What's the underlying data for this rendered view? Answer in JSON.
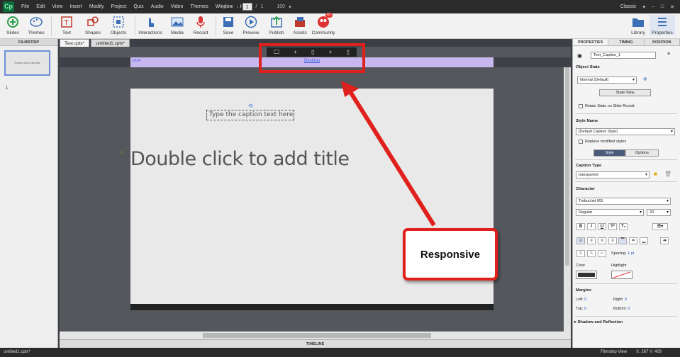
{
  "app": {
    "logo": "Cp",
    "workspace": "Classic"
  },
  "menu": [
    "File",
    "Edit",
    "View",
    "Insert",
    "Modify",
    "Project",
    "Quiz",
    "Audio",
    "Video",
    "Themes",
    "Window",
    "Help"
  ],
  "slide_nav": {
    "current": "1",
    "separator": "/",
    "total": "1",
    "zoom": "100"
  },
  "toolbar": {
    "slides": "Slides",
    "themes": "Themes",
    "text": "Text",
    "shapes": "Shapes",
    "objects": "Objects",
    "interactions": "Interactions",
    "media": "Media",
    "record": "Record",
    "save": "Save",
    "preview": "Preview",
    "publish": "Publish",
    "assets": "Assets",
    "community": "Community",
    "community_badge": "41",
    "library": "Library",
    "properties": "Properties"
  },
  "filmstrip": {
    "header": "FILMSTRIP",
    "thumb_text": "Double click to add title",
    "slide_number": "1"
  },
  "tabs": [
    "Test.cptx*",
    "untitled1.cptx*"
  ],
  "stage": {
    "breakpoint_start": "1024",
    "breakpoint_name": "Desktop",
    "title_placeholder": "Double click to add title",
    "caption_placeholder": "Type the caption text here"
  },
  "annotation": {
    "callout_text": "Responsive",
    "color": "#e0201c"
  },
  "timeline": "TIMELINE",
  "props": {
    "tabs": [
      "PROPERTIES",
      "TIMING",
      "POSITION"
    ],
    "object_name": "Text_Caption_1",
    "object_state_head": "Object State",
    "state_value": "Normal (Default)",
    "state_view_btn": "State View",
    "retain_state": "Retain State on Slide Revisit",
    "style_name_head": "Style Name",
    "style_value": "[Default Caption Style]",
    "replace_styles": "Replace modified styles",
    "subtab_style": "Style",
    "subtab_options": "Options",
    "caption_type_head": "Caption Type",
    "caption_type": "transparent",
    "character_head": "Character",
    "font": "Trebuchet MS",
    "font_style": "Regular",
    "font_size": "20",
    "spacing_label": "Spacing:",
    "spacing_value": "1 pt",
    "color_label": "Color",
    "highlight_label": "Highlight",
    "margins_head": "Margins",
    "left_label": "Left:",
    "left_value": "0",
    "right_label": "Right:",
    "right_value": "0",
    "top_label": "Top:",
    "top_value": "0",
    "bottom_label": "Bottom:",
    "bottom_value": "0",
    "shadow_head": "Shadow and Reflection"
  },
  "status": {
    "file": "untitled1.cptx*",
    "view": "Filmstrip View",
    "coords": "X: 267 Y: 409"
  }
}
